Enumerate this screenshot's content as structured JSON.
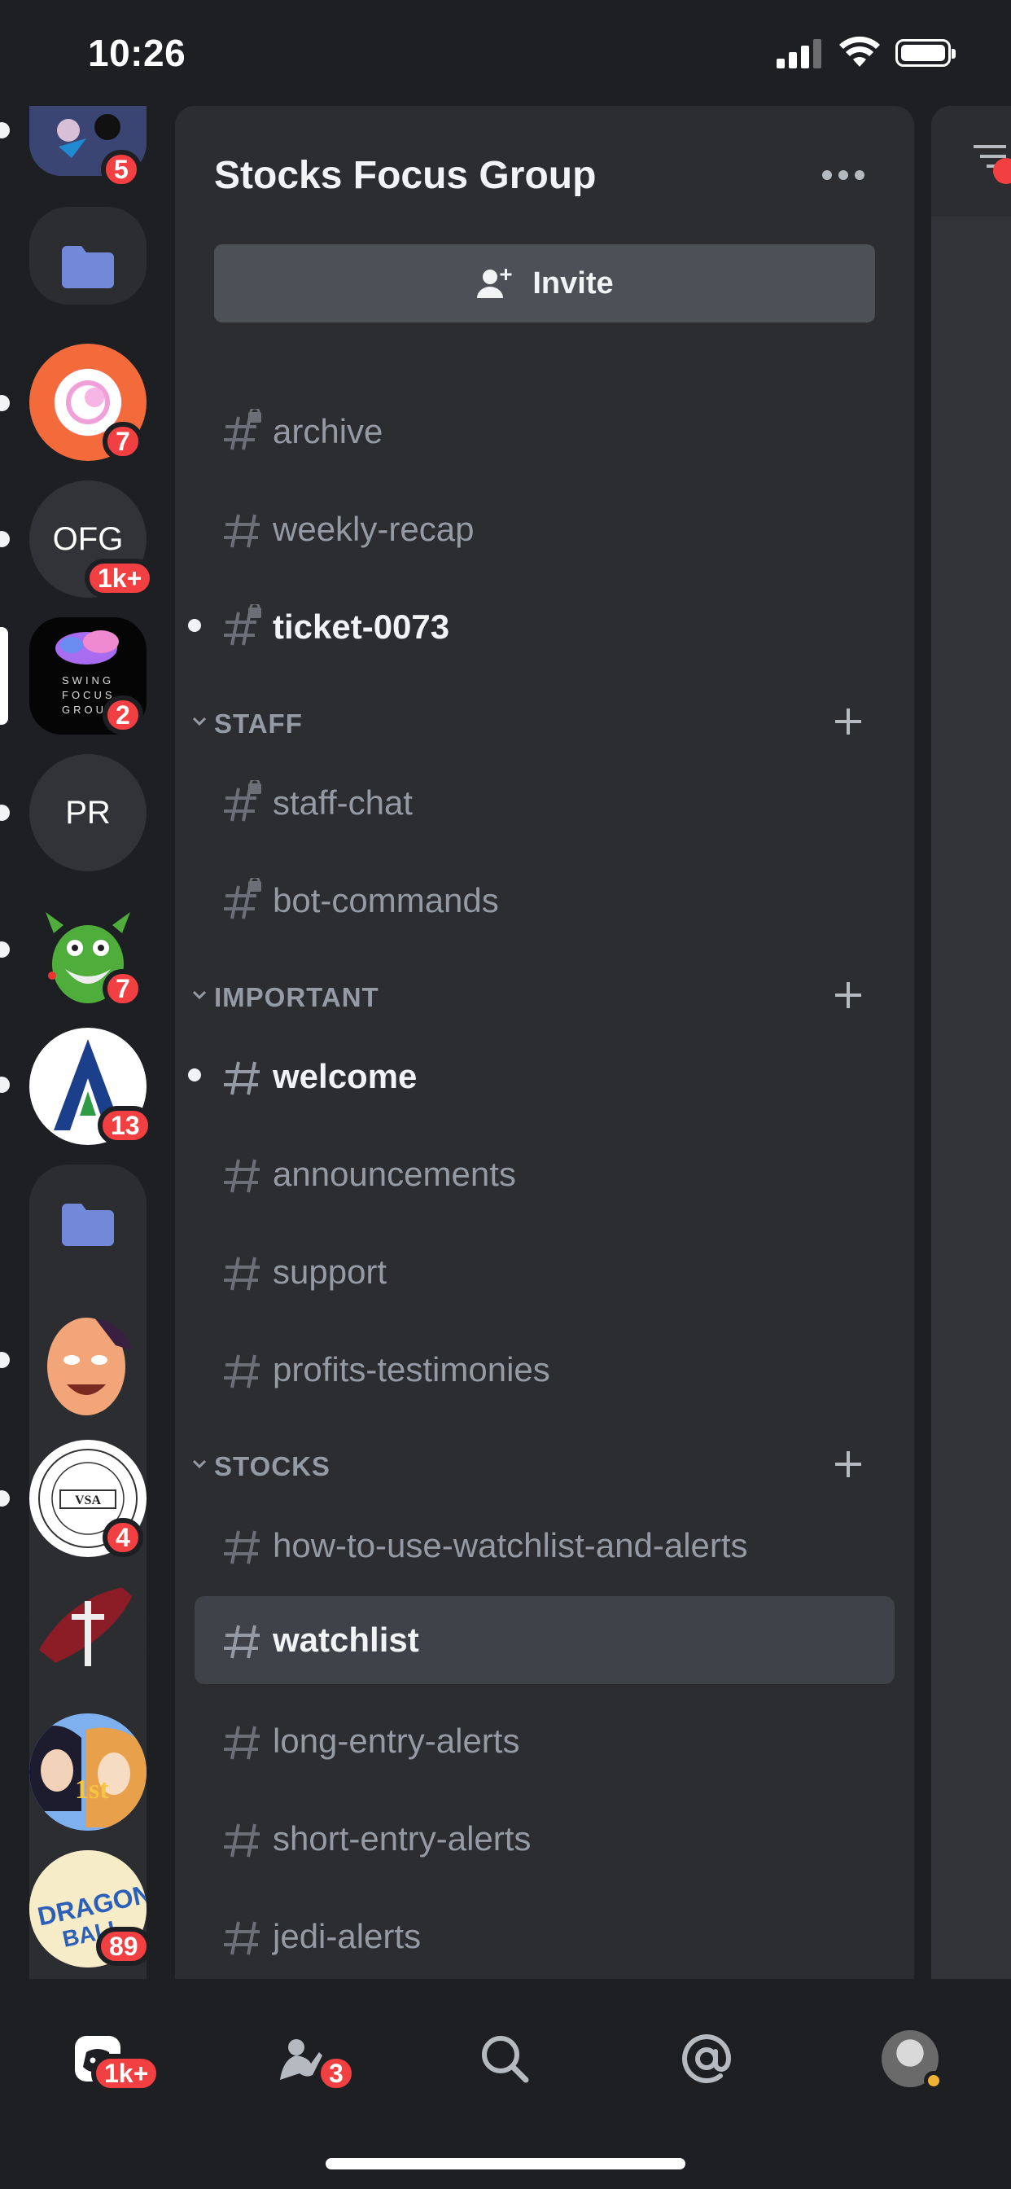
{
  "status_bar": {
    "time": "10:26"
  },
  "server_rail": {
    "badges": {
      "top_server": "5",
      "pink_server": "7",
      "ofg": "1k+",
      "swing_focus_group": "2",
      "monster": "7",
      "a_server": "13",
      "vsa": "4",
      "dragon_ball": "89"
    },
    "ofg_label": "OFG",
    "pr_label": "PR",
    "swing_text": "SWING FOCUS GROUP",
    "vsa_text": "VSA"
  },
  "channel_panel": {
    "server_name": "Stocks Focus Group",
    "invite_label": "Invite",
    "uncategorized": [
      {
        "label": "archive",
        "locked": true,
        "unread": false
      },
      {
        "label": "weekly-recap",
        "locked": false,
        "unread": false
      },
      {
        "label": "ticket-0073",
        "locked": true,
        "unread": true
      }
    ],
    "categories": [
      {
        "label": "STAFF",
        "channels": [
          {
            "label": "staff-chat",
            "locked": true
          },
          {
            "label": "bot-commands",
            "locked": true
          }
        ]
      },
      {
        "label": "IMPORTANT",
        "channels": [
          {
            "label": "welcome",
            "unread": true
          },
          {
            "label": "announcements"
          },
          {
            "label": "support"
          },
          {
            "label": "profits-testimonies"
          }
        ]
      },
      {
        "label": "STOCKS",
        "channels": [
          {
            "label": "how-to-use-watchlist-and-alerts"
          },
          {
            "label": "watchlist",
            "selected": true
          },
          {
            "label": "long-entry-alerts"
          },
          {
            "label": "short-entry-alerts"
          },
          {
            "label": "jedi-alerts"
          }
        ]
      }
    ]
  },
  "bottom_nav": {
    "home_badge": "1k+",
    "friends_badge": "3"
  },
  "colors": {
    "background": "#1e1f22",
    "panel": "#2b2d31",
    "selected": "#404249",
    "badge": "#f23f42",
    "folder": "#7289da"
  }
}
